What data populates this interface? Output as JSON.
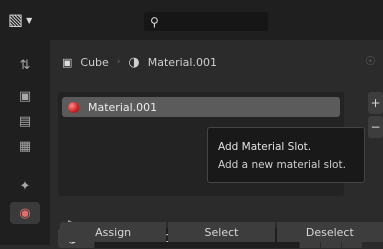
{
  "header": {
    "editor_type_icon": "properties-editor-icon",
    "search": {
      "icon": "search-icon",
      "value": ""
    }
  },
  "sidebar": {
    "tabs": [
      {
        "icon": "tool-icon",
        "glyph": "↑↓"
      },
      {
        "icon": "render-icon",
        "glyph": "□"
      },
      {
        "icon": "output-icon",
        "glyph": "▣"
      },
      {
        "icon": "view-layer-icon",
        "glyph": "▦"
      },
      {
        "icon": "object-data-icon",
        "glyph": "✦"
      },
      {
        "icon": "material-icon",
        "glyph": "●",
        "active": true
      }
    ]
  },
  "breadcrumb": {
    "object": "Cube",
    "material": "Material.001"
  },
  "slots": [
    {
      "name": "Material.001",
      "color": "#cc2222"
    }
  ],
  "side_buttons": {
    "add": "+",
    "remove": "−"
  },
  "tooltip": {
    "title": "Add Material Slot.",
    "description": "Add a new material slot."
  },
  "material_field": {
    "value": "Material.001"
  },
  "actions": {
    "assign": "Assign",
    "select": "Select",
    "deselect": "Deselect"
  }
}
